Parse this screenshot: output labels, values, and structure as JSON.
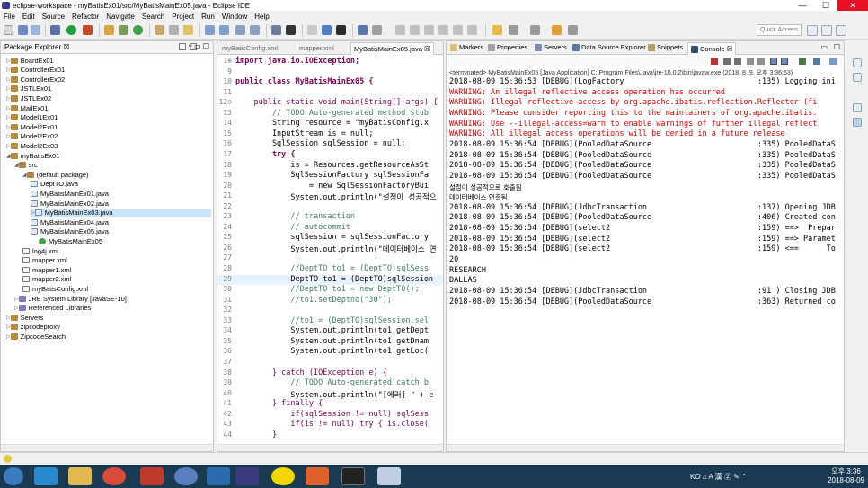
{
  "window": {
    "title": "eclipse-workspace - myBatisEx01/src/MyBatisMainEx05.java - Eclipse IDE",
    "controls": {
      "minimize": "—",
      "maximize": "☐",
      "close": "✕"
    }
  },
  "menu": [
    "File",
    "Edit",
    "Source",
    "Refactor",
    "Navigate",
    "Search",
    "Project",
    "Run",
    "Window",
    "Help"
  ],
  "toolbar": {
    "quick_access_placeholder": "Quick Access"
  },
  "package_explorer": {
    "tab_label": "Package Explorer ☒",
    "items": [
      {
        "label": "BoardEx01",
        "level": 0,
        "icon": "project-icon"
      },
      {
        "label": "ControllerEx01",
        "level": 0,
        "icon": "project-icon"
      },
      {
        "label": "ControllerEx02",
        "level": 0,
        "icon": "project-icon"
      },
      {
        "label": "JSTLEx01",
        "level": 0,
        "icon": "project-icon"
      },
      {
        "label": "JSTLEx02",
        "level": 0,
        "icon": "project-icon"
      },
      {
        "label": "MailEx01",
        "level": 0,
        "icon": "project-icon"
      },
      {
        "label": "Model1Ex01",
        "level": 0,
        "icon": "project-icon"
      },
      {
        "label": "Model2Ex01",
        "level": 0,
        "icon": "project-icon"
      },
      {
        "label": "Model2Ex02",
        "level": 0,
        "icon": "project-icon"
      },
      {
        "label": "Model2Ex03",
        "level": 0,
        "icon": "project-icon"
      },
      {
        "label": "myBatisEx01",
        "level": 0,
        "icon": "project-icon"
      },
      {
        "label": "src",
        "level": 1,
        "icon": "source-folder-icon"
      },
      {
        "label": "(default package)",
        "level": 2,
        "icon": "package-icon"
      },
      {
        "label": "DeptTO.java",
        "level": 3,
        "icon": "java-file-icon"
      },
      {
        "label": "MyBatisMainEx01.java",
        "level": 3,
        "icon": "java-file-icon"
      },
      {
        "label": "MyBatisMainEx02.java",
        "level": 3,
        "icon": "java-file-icon"
      },
      {
        "label": "MyBatisMainEx03.java",
        "level": 3,
        "icon": "java-file-icon",
        "selected": true
      },
      {
        "label": "MyBatisMainEx04.java",
        "level": 3,
        "icon": "java-file-icon"
      },
      {
        "label": "MyBatisMainEx05.java",
        "level": 3,
        "icon": "java-file-icon"
      },
      {
        "label": "MyBatisMainEx05",
        "level": 4,
        "icon": "class-icon"
      },
      {
        "label": "log4j.xml",
        "level": 2,
        "icon": "xml-file-icon"
      },
      {
        "label": "mapper.xml",
        "level": 2,
        "icon": "xml-file-icon"
      },
      {
        "label": "mapper1.xml",
        "level": 2,
        "icon": "xml-file-icon"
      },
      {
        "label": "mapper2.xml",
        "level": 2,
        "icon": "xml-file-icon"
      },
      {
        "label": "myBatisConfig.xml",
        "level": 2,
        "icon": "xml-file-icon"
      },
      {
        "label": "JRE System Library [JavaSE-10]",
        "level": 1,
        "icon": "library-icon"
      },
      {
        "label": "Referenced Libraries",
        "level": 1,
        "icon": "library-icon"
      },
      {
        "label": "Servers",
        "level": 0,
        "icon": "project-icon"
      },
      {
        "label": "zipcodeproxy",
        "level": 0,
        "icon": "project-icon"
      },
      {
        "label": "ZipcodeSearch",
        "level": 0,
        "icon": "project-icon"
      }
    ]
  },
  "editor": {
    "tabs": [
      {
        "label": "myBatisConfig.xml",
        "active": false
      },
      {
        "label": "mapper.xml",
        "active": false
      },
      {
        "label": "MyBatisMainEx05.java ☒",
        "active": true
      }
    ],
    "lines": [
      {
        "n": "1⊕",
        "text": "import java.io.IOException;"
      },
      {
        "n": "9",
        "text": ""
      },
      {
        "n": "10",
        "text": "public class MyBatisMainEx05 {"
      },
      {
        "n": "11",
        "text": ""
      },
      {
        "n": "12⊖",
        "text": "    public static void main(String[] args) {"
      },
      {
        "n": "13",
        "text": "        // TODO Auto-generated method stub"
      },
      {
        "n": "14",
        "text": "        String resource = \"myBatisConfig.x"
      },
      {
        "n": "15",
        "text": "        InputStream is = null;"
      },
      {
        "n": "16",
        "text": "        SqlSession sqlSession = null;"
      },
      {
        "n": "17",
        "text": "        try {"
      },
      {
        "n": "18",
        "text": "            is = Resources.getResourceAsSt"
      },
      {
        "n": "19",
        "text": "            SqlSessionFactory sqlSessionFa"
      },
      {
        "n": "20",
        "text": "                = new SqlSessionFactoryBui"
      },
      {
        "n": "21",
        "text": "            System.out.println(\"설정이 성공적으"
      },
      {
        "n": "22",
        "text": ""
      },
      {
        "n": "23",
        "text": "            // transaction"
      },
      {
        "n": "24",
        "text": "            // autocommit"
      },
      {
        "n": "25",
        "text": "            sqlSession = sqlSessionFactory"
      },
      {
        "n": "26",
        "text": "            System.out.println(\"데이터베이스 연"
      },
      {
        "n": "27",
        "text": ""
      },
      {
        "n": "28",
        "text": "            //DeptTO to1 = (DeptTO)sqlSess"
      },
      {
        "n": "29",
        "text": "            DeptTO to1 = (DeptTO)sqlSession"
      },
      {
        "n": "30",
        "text": "            //DeptTO to1 = new DeptTO();"
      },
      {
        "n": "31",
        "text": "            //to1.setDeptno(\"30\");"
      },
      {
        "n": "32",
        "text": ""
      },
      {
        "n": "33",
        "text": "            //to1 = (DeptTO)sqlSession.sel"
      },
      {
        "n": "34",
        "text": "            System.out.println(to1.getDept"
      },
      {
        "n": "35",
        "text": "            System.out.println(to1.getDnam"
      },
      {
        "n": "36",
        "text": "            System.out.println(to1.getLoc("
      },
      {
        "n": "37",
        "text": ""
      },
      {
        "n": "38",
        "text": "        } catch (IOException e) {"
      },
      {
        "n": "39",
        "text": "            // TODO Auto-generated catch b"
      },
      {
        "n": "40",
        "text": "            System.out.println(\"[에러] \" + e"
      },
      {
        "n": "41",
        "text": "        } finally {"
      },
      {
        "n": "42",
        "text": "            if(sqlSession != null) sqlSess"
      },
      {
        "n": "43",
        "text": "            if(is != null) try { is.close("
      },
      {
        "n": "44",
        "text": "        }"
      }
    ]
  },
  "console": {
    "tabs": [
      {
        "label": "Markers",
        "active": false
      },
      {
        "label": "Properties",
        "active": false
      },
      {
        "label": "Servers",
        "active": false
      },
      {
        "label": "Data Source Explorer",
        "active": false
      },
      {
        "label": "Snippets",
        "active": false
      },
      {
        "label": "Console ☒",
        "active": true
      }
    ],
    "terminated": "<terminated> MyBatisMainEx05 [Java Application] C:\\Program Files\\Java\\jre-10.0.2\\bin\\javaw.exe (2018. 8. 9. 오후 3:36:53)",
    "lines": [
      {
        "text": "2018-08-09 15:36:53 [DEBUG](LogFactory                             :135) Logging ini",
        "type": "normal"
      },
      {
        "text": "WARNING: An illegal reflective access operation has occurred",
        "type": "err"
      },
      {
        "text": "WARNING: Illegal reflective access by org.apache.ibatis.reflection.Reflector (fi",
        "type": "err"
      },
      {
        "text": "WARNING: Please consider reporting this to the maintainers of org.apache.ibatis.",
        "type": "err"
      },
      {
        "text": "WARNING: Use --illegal-access=warn to enable warnings of further illegal reflect",
        "type": "err"
      },
      {
        "text": "WARNING: All illegal access operations will be denied in a future release",
        "type": "err"
      },
      {
        "text": "2018-08-09 15:36:54 [DEBUG](PooledDataSource                       :335) PooledDataS",
        "type": "normal"
      },
      {
        "text": "2018-08-09 15:36:54 [DEBUG](PooledDataSource                       :335) PooledDataS",
        "type": "normal"
      },
      {
        "text": "2018-08-09 15:36:54 [DEBUG](PooledDataSource                       :335) PooledDataS",
        "type": "normal"
      },
      {
        "text": "2018-08-09 15:36:54 [DEBUG](PooledDataSource                       :335) PooledDataS",
        "type": "normal"
      },
      {
        "text": "설정이 성공적으로 호출됨",
        "type": "kr"
      },
      {
        "text": "데이터베이스 연결됨",
        "type": "kr"
      },
      {
        "text": "2018-08-09 15:36:54 [DEBUG](JdbcTransaction                        :137) Opening JDB",
        "type": "normal"
      },
      {
        "text": "2018-08-09 15:36:54 [DEBUG](PooledDataSource                       :406) Created con",
        "type": "normal"
      },
      {
        "text": "2018-08-09 15:36:54 [DEBUG](select2                                :159) ==>  Prepar",
        "type": "normal"
      },
      {
        "text": "2018-08-09 15:36:54 [DEBUG](select2                                :159) ==> Paramet",
        "type": "normal"
      },
      {
        "text": "2018-08-09 15:36:54 [DEBUG](select2                                :159) <==      To",
        "type": "normal"
      },
      {
        "text": "20",
        "type": "normal"
      },
      {
        "text": "RESEARCH",
        "type": "normal"
      },
      {
        "text": "DALLAS",
        "type": "normal"
      },
      {
        "text": "2018-08-09 15:36:54 [DEBUG](JdbcTransaction                        :91 ) Closing JDB",
        "type": "normal"
      },
      {
        "text": "2018-08-09 15:36:54 [DEBUG](PooledDataSource                       :363) Returned co",
        "type": "normal"
      }
    ]
  },
  "taskbar": {
    "time": "오후 3:36",
    "date": "2018-08-09",
    "tray_text": "KO ⌂ A 漢 ② ✎ ⌃"
  },
  "colors": {
    "error_red": "#e00000",
    "selection_blue": "#cce4f7",
    "taskbar_bg": "#1a3a52",
    "keyword_purple": "#7f0055",
    "comment_green": "#3f7f5f",
    "string_blue": "#2a00ff"
  }
}
